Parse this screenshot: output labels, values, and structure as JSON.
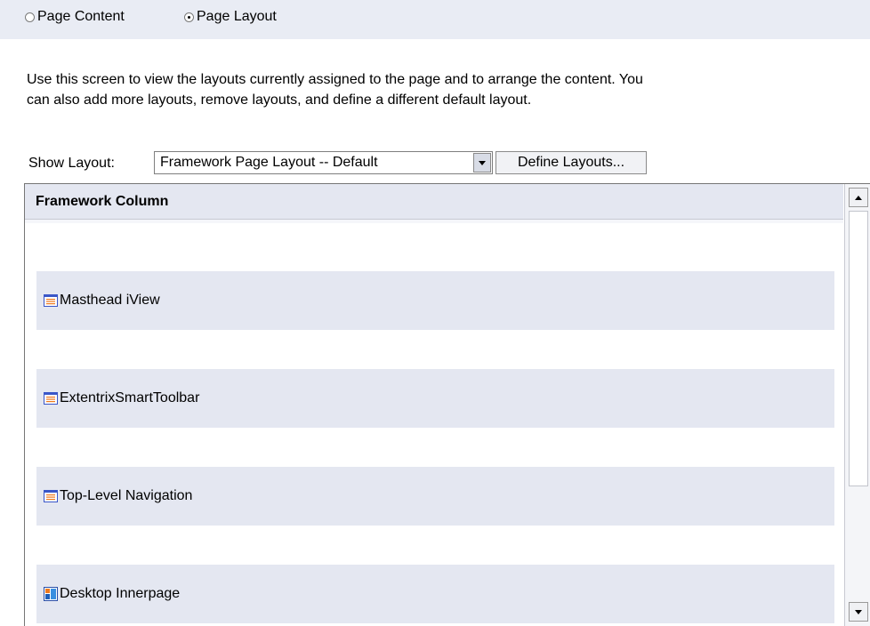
{
  "view_toggle": {
    "options": [
      {
        "label": "Page Content",
        "selected": false
      },
      {
        "label": "Page Layout",
        "selected": true
      }
    ]
  },
  "description": "Use this screen to view the layouts currently assigned to the page and to arrange the content. You\ncan also add more layouts, remove layouts, and define a different default layout.",
  "layout_selector": {
    "label": "Show Layout:",
    "selected_value": "Framework Page Layout -- Default",
    "define_button_label": "Define Layouts..."
  },
  "layout_panel": {
    "header": "Framework Column",
    "items": [
      {
        "label": "Masthead iView",
        "icon": "iview-icon"
      },
      {
        "label": "ExtentrixSmartToolbar",
        "icon": "iview-icon"
      },
      {
        "label": "Top-Level Navigation",
        "icon": "iview-icon"
      },
      {
        "label": "Desktop Innerpage",
        "icon": "page-icon"
      }
    ]
  },
  "colors": {
    "header_bg": "#e4e7f1",
    "item_bg": "#e4e7f1",
    "iview_icon_blue": "#3a56c8",
    "iview_icon_orange": "#f07a1e"
  }
}
